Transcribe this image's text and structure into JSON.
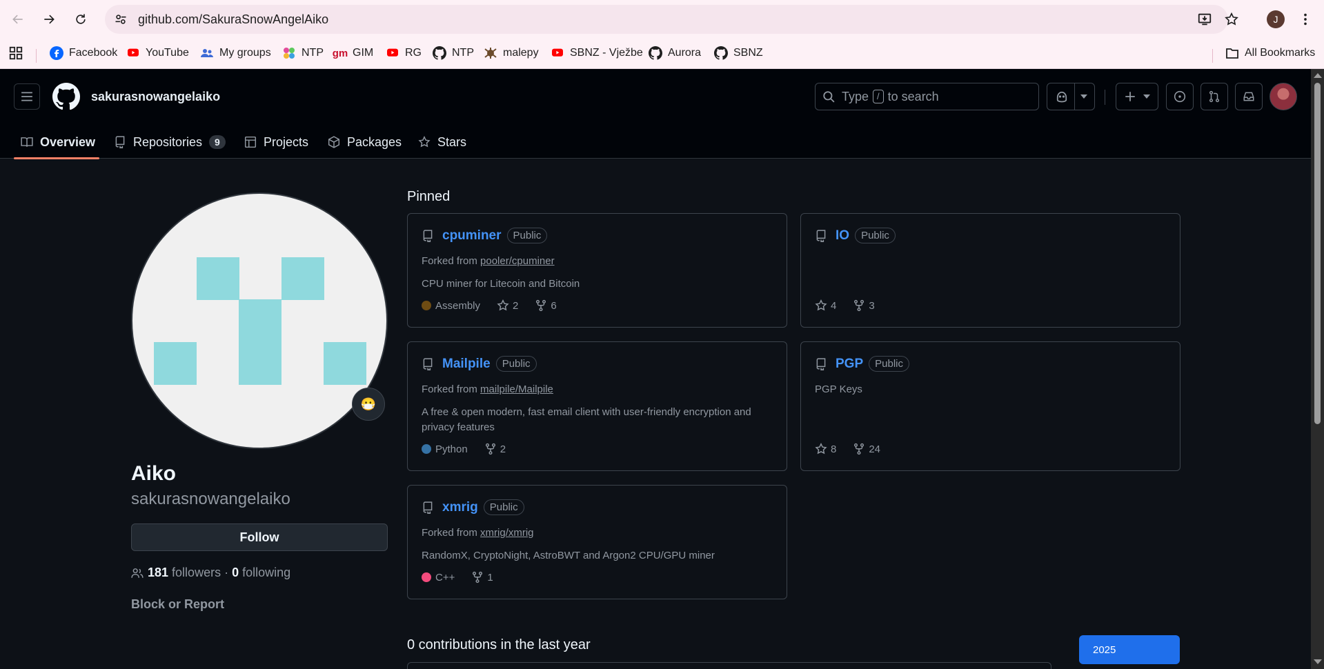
{
  "browser": {
    "url": "github.com/SakuraSnowAngelAiko",
    "profile_initial": "J",
    "bookmarks": [
      {
        "label": "Facebook",
        "icon": "facebook-icon"
      },
      {
        "label": "YouTube",
        "icon": "youtube-icon"
      },
      {
        "label": "My groups",
        "icon": "groups-icon"
      },
      {
        "label": "NTP",
        "icon": "ntp-icon"
      },
      {
        "label": "GIM",
        "icon": "gim-icon"
      },
      {
        "label": "RG",
        "icon": "youtube-icon"
      },
      {
        "label": "NTP",
        "icon": "github-icon"
      },
      {
        "label": "malepy",
        "icon": "malepy-icon"
      },
      {
        "label": "SBNZ - Vježbe",
        "icon": "youtube-icon"
      },
      {
        "label": "Aurora",
        "icon": "github-icon"
      },
      {
        "label": "SBNZ",
        "icon": "github-icon"
      }
    ],
    "all_bookmarks": "All Bookmarks"
  },
  "header": {
    "username": "sakurasnowangelaiko",
    "search_prefix": "Type",
    "search_key": "/",
    "search_suffix": "to search"
  },
  "tabs": [
    {
      "label": "Overview",
      "icon": "book-icon",
      "active": true
    },
    {
      "label": "Repositories",
      "icon": "repo-icon",
      "count": "9"
    },
    {
      "label": "Projects",
      "icon": "table-icon"
    },
    {
      "label": "Packages",
      "icon": "package-icon"
    },
    {
      "label": "Stars",
      "icon": "star-icon"
    }
  ],
  "profile": {
    "name": "Aiko",
    "login": "sakurasnowangelaiko",
    "follow_label": "Follow",
    "followers_count": "181",
    "followers_label": "followers",
    "separator": "·",
    "following_count": "0",
    "following_label": "following",
    "block_label": "Block or Report",
    "status_emoji": "😷"
  },
  "pinned": {
    "title": "Pinned",
    "repos": [
      {
        "name": "cpuminer",
        "visibility": "Public",
        "forked_prefix": "Forked from",
        "forked_from": "pooler/cpuminer",
        "description": "CPU miner for Litecoin and Bitcoin",
        "language": "Assembly",
        "language_color": "#6E4C13",
        "stars": "2",
        "forks": "6"
      },
      {
        "name": "IO",
        "visibility": "Public",
        "stars": "4",
        "forks": "3"
      },
      {
        "name": "Mailpile",
        "visibility": "Public",
        "forked_prefix": "Forked from",
        "forked_from": "mailpile/Mailpile",
        "description": "A free & open modern, fast email client with user-friendly encryption and privacy features",
        "language": "Python",
        "language_color": "#3572A5",
        "forks": "2"
      },
      {
        "name": "PGP",
        "visibility": "Public",
        "description": "PGP Keys",
        "stars": "8",
        "forks": "24"
      },
      {
        "name": "xmrig",
        "visibility": "Public",
        "forked_prefix": "Forked from",
        "forked_from": "xmrig/xmrig",
        "description": "RandomX, CryptoNight, AstroBWT and Argon2 CPU/GPU miner",
        "language": "C++",
        "language_color": "#f34b7d",
        "forks": "1"
      }
    ]
  },
  "contributions": {
    "title": "0 contributions in the last year",
    "year": "2025"
  },
  "colors": {
    "accent": "#4493f8",
    "tab_underline": "#f78166",
    "year_button": "#1f6feb",
    "identicon": "#8fd9dd"
  }
}
